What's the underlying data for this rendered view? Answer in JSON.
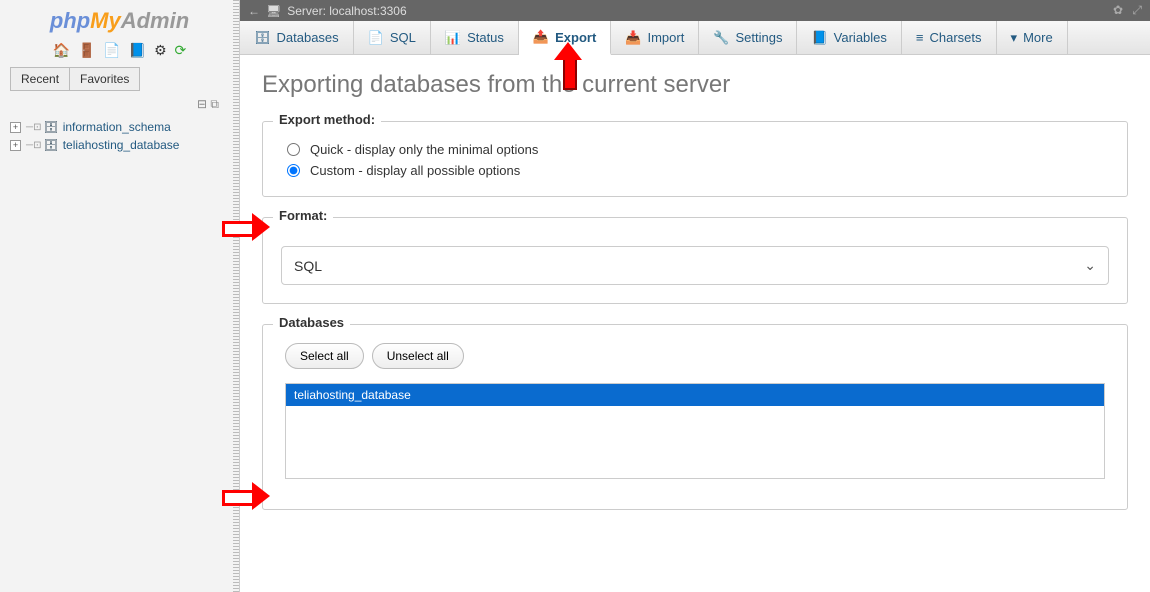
{
  "logo": {
    "p1": "php",
    "p2": "My",
    "p3": "Admin"
  },
  "sidebar": {
    "tabs": {
      "recent": "Recent",
      "favorites": "Favorites"
    },
    "databases": [
      {
        "name": "information_schema"
      },
      {
        "name": "teliahosting_database"
      }
    ]
  },
  "server": {
    "label": "Server: localhost:3306"
  },
  "tabs": [
    {
      "label": "Databases",
      "icon": "🗄"
    },
    {
      "label": "SQL",
      "icon": "📄"
    },
    {
      "label": "Status",
      "icon": "📊"
    },
    {
      "label": "Export",
      "icon": "📤",
      "active": true
    },
    {
      "label": "Import",
      "icon": "📥"
    },
    {
      "label": "Settings",
      "icon": "🔧"
    },
    {
      "label": "Variables",
      "icon": "📘"
    },
    {
      "label": "Charsets",
      "icon": "≡"
    },
    {
      "label": "More",
      "icon": "▾"
    }
  ],
  "page": {
    "title": "Exporting databases from the current server"
  },
  "export_method": {
    "legend": "Export method:",
    "quick": "Quick - display only the minimal options",
    "custom": "Custom - display all possible options",
    "selected": "custom"
  },
  "format": {
    "legend": "Format:",
    "value": "SQL"
  },
  "databases_section": {
    "legend": "Databases",
    "select_all": "Select all",
    "unselect_all": "Unselect all",
    "items": [
      {
        "name": "teliahosting_database",
        "selected": true
      }
    ]
  }
}
